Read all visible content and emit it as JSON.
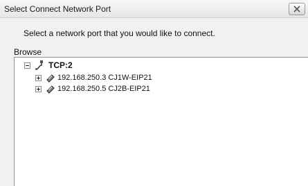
{
  "dialog": {
    "title": "Select Connect Network Port",
    "prompt": "Select a network port that you would like to connect.",
    "browse_label": "Browse",
    "close_icon": "close-icon"
  },
  "tree": {
    "root": {
      "label": "TCP:2",
      "icon": "network-cable-icon",
      "expanded": true
    },
    "children": [
      {
        "label": "192.168.250.3 CJ1W-EIP21",
        "icon": "network-port-icon",
        "expanded": false
      },
      {
        "label": "192.168.250.5 CJ2B-EIP21",
        "icon": "network-port-icon",
        "expanded": false
      }
    ]
  }
}
